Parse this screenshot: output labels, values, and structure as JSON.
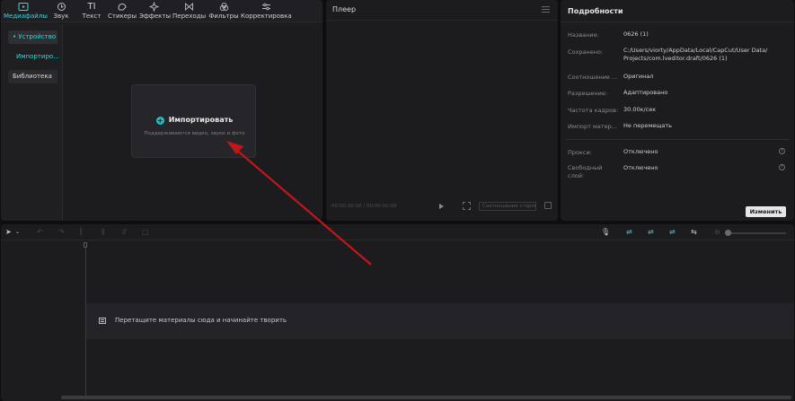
{
  "media": {
    "tabs": [
      {
        "label": "Медиафайлы",
        "icon": "media-icon",
        "active": true
      },
      {
        "label": "Звук",
        "icon": "audio-icon"
      },
      {
        "label": "Текст",
        "icon": "text-icon",
        "glyph": "TI"
      },
      {
        "label": "Стикеры",
        "icon": "sticker-icon"
      },
      {
        "label": "Эффекты",
        "icon": "effects-icon"
      },
      {
        "label": "Переходы",
        "icon": "transitions-icon"
      },
      {
        "label": "Фильтры",
        "icon": "filters-icon"
      },
      {
        "label": "Корректировка",
        "icon": "adjust-icon"
      }
    ],
    "sidebar": [
      {
        "label": "• Устройство"
      },
      {
        "label": "Импортиро..."
      },
      {
        "label": "Библиотека"
      }
    ],
    "import_title": "Импортировать",
    "import_subtitle": "Поддерживаются видео, звуки и фото"
  },
  "player": {
    "title": "Плеер",
    "timecode": "00:00:00:00 / 00:00:00:00",
    "ratio_button": "Соотношение сторон"
  },
  "details": {
    "title": "Подробности",
    "rows": [
      {
        "label": "Название:",
        "value": "0626 (1)"
      },
      {
        "label": "Сохранено:",
        "value": "C:/Users/viorty/AppData/Local/CapCut/User Data/ Projects/com.lveditor.draft/0626 (1)"
      },
      {
        "label": "Соотношение ...",
        "value": "Оригинал"
      },
      {
        "label": "Разрешение:",
        "value": "Адаптировано"
      },
      {
        "label": "Частота кадров:",
        "value": "30.00к/сек"
      },
      {
        "label": "Импорт матер...",
        "value": "Не перемещать"
      },
      {
        "label": "Прокси:",
        "value": "Отключено"
      },
      {
        "label": "Свободный слой:",
        "value": "Отключено"
      }
    ],
    "edit_button": "Изменить"
  },
  "timeline": {
    "drop_text": "Перетащите материалы сюда и начинайте творить",
    "accent": "#3ad6d9"
  }
}
